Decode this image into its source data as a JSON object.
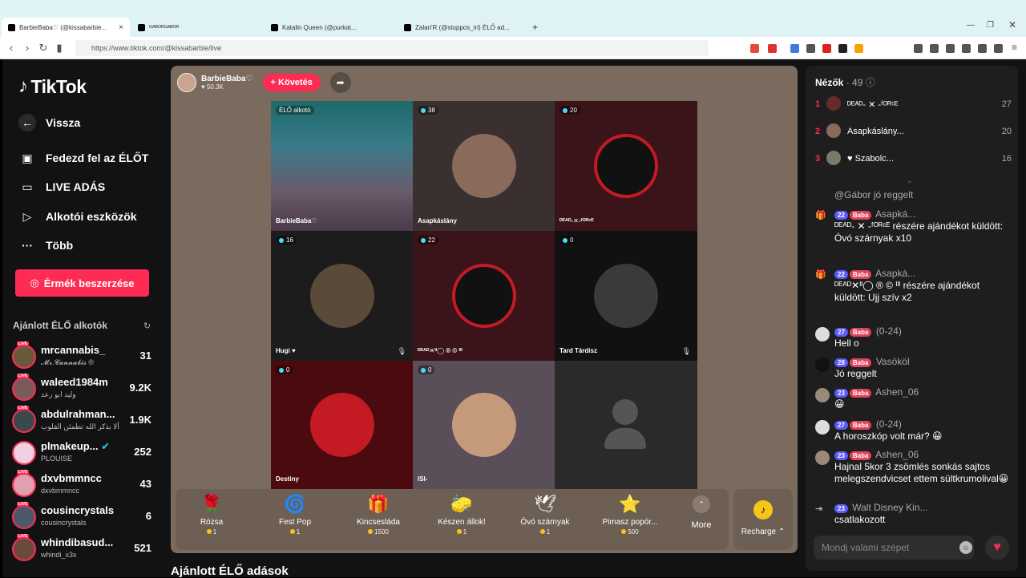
{
  "browser": {
    "tabs": [
      {
        "label": "BarbieBaba♡ (@kissabarbie...",
        "close": "×"
      },
      {
        "label": "ᴳᴬᴮᴼᴿᴳᴬᴮᴼᴿ"
      },
      {
        "label": "Katalin Queen (@purkat..."
      },
      {
        "label": "Zalan'R (@stoppos_iri) ÉLŐ ad..."
      }
    ],
    "new_tab": "+",
    "url": "https://www.tiktok.com/@kissabarbie/live"
  },
  "sidebar": {
    "logo": "TikTok",
    "back": "Vissza",
    "nav": [
      {
        "label": "Fedezd fel az ÉLŐT",
        "icon": "calendar-icon"
      },
      {
        "label": "LIVE ADÁS",
        "icon": "camera-icon"
      },
      {
        "label": "Alkotói eszközök",
        "icon": "play-icon"
      },
      {
        "label": "Több",
        "icon": "dots-icon"
      }
    ],
    "coins_button": "Érmék beszerzése",
    "recommended_title": "Ajánlott ÉLŐ alkotók",
    "recommended": [
      {
        "name": "mrcannabis_",
        "sub": "𝓜𝓻.𝓒𝓪𝓷𝓷𝓪𝓫𝓲𝓼 ®",
        "count": "31",
        "live": "LIVE"
      },
      {
        "name": "waleed1984m",
        "sub": "وليد ابو رعد",
        "count": "9.2K",
        "live": "LIVE"
      },
      {
        "name": "abdulrahman...",
        "sub": "ألا بذكر الله تطمئن القلوب",
        "count": "1.9K",
        "live": "LIVE"
      },
      {
        "name": "plmakeup...",
        "sub": "PLOUISE",
        "count": "252",
        "live": ""
      },
      {
        "name": "dxvbmmncc",
        "sub": "dxvbmmncc",
        "count": "43",
        "live": "LIVE"
      },
      {
        "name": "cousincrystals",
        "sub": "cousincrystals",
        "count": "6",
        "live": "LIVE"
      },
      {
        "name": "whindibasud...",
        "sub": "whindi_x3x",
        "count": "521",
        "live": "LIVE"
      }
    ],
    "bottom_title": "Ajánlott ÉLŐ adások"
  },
  "stage": {
    "host_name": "BarbieBaba♡",
    "host_likes": "♥ 50.3K",
    "follow": "+ Követés",
    "cells": [
      {
        "badge": "ÉLŐ alkotó",
        "label": "BarbieBaba♡",
        "bg": "#2b5a6a"
      },
      {
        "badge": "38",
        "label": "Asapkáslány",
        "bg": "#3a3030"
      },
      {
        "badge": "20",
        "label": "ᴰᴱᴬᴰ-✕-ᶠᴼᴿᶜᴱ",
        "bg": "#3a1418"
      },
      {
        "badge": "16",
        "label": "Hugi ♥",
        "bg": "#1c1c1c"
      },
      {
        "badge": "22",
        "label": "ᴰᴱᴬᴰ✕ᴵᴵ◯ ® © ᴵᴵᴵ",
        "bg": "#3a1418"
      },
      {
        "badge": "0",
        "label": "Tard Tárdisz",
        "bg": "#111"
      },
      {
        "badge": "0",
        "label": "Destiny",
        "bg": "#4a0a0e"
      },
      {
        "badge": "0",
        "label": "ISI-",
        "bg": "#5a4e58"
      },
      {
        "badge": "",
        "label": "",
        "bg": "#2a2a2a"
      }
    ],
    "gifts": [
      {
        "icon": "🌹",
        "name": "Rózsa",
        "price": "1"
      },
      {
        "icon": "🌀",
        "name": "Fest Pop",
        "price": "1"
      },
      {
        "icon": "🎁",
        "name": "Kincsesláda",
        "price": "1500"
      },
      {
        "icon": "🧽",
        "name": "Készen állok!",
        "price": "1"
      },
      {
        "icon": "🕊",
        "name": "Óvó szárnyak",
        "price": "1"
      },
      {
        "icon": "⭐",
        "name": "Pimasz popór...",
        "price": "500"
      }
    ],
    "more": "More",
    "recharge": "Recharge ⌃"
  },
  "chat": {
    "viewers_label": "Nézők",
    "viewers_count": "· 49",
    "viewers": [
      {
        "rank": "1",
        "name": "ᴰᴱᴬᴰ- ✕ -ᶠᴼᴿᶜᴱ",
        "score": "27"
      },
      {
        "rank": "2",
        "name": "Asapkáslány...",
        "score": "20"
      },
      {
        "rank": "3",
        "name": "♥ Szabolc...",
        "score": "16"
      }
    ],
    "messages": [
      {
        "lvl": "",
        "tag": "",
        "user": "",
        "text": "@Gábor jó reggelt"
      },
      {
        "lvl": "22",
        "tag": "Baba",
        "user": "Asapká...",
        "text": "ᴰᴱᴬᴰ- ✕ -ᶠᴼᴿᶜᴱ részére ajándékot küldött: Óvó szárnyak x10"
      },
      {
        "lvl": "22",
        "tag": "Baba",
        "user": "Asapká...",
        "text": "ᴰᴱᴬᴰ✕ᴵᴵ◯ ® © ᴵᴵᴵ részére ajándékot küldött: Ujj szív x2"
      },
      {
        "lvl": "27",
        "tag": "Baba",
        "user": "(0-24)",
        "text": "Hell o"
      },
      {
        "lvl": "28",
        "tag": "Baba",
        "user": "Vasököl",
        "text": "Jó reggelt"
      },
      {
        "lvl": "23",
        "tag": "Baba",
        "user": "Ashen_06",
        "text": "😀"
      },
      {
        "lvl": "27",
        "tag": "Baba",
        "user": "(0-24)",
        "text": "A horoszkóp volt már? 😀"
      },
      {
        "lvl": "23",
        "tag": "Baba",
        "user": "Ashen_06",
        "text": "Hajnal 5kor 3 zsömlés sonkás sajtos melegszendvicset ettem sültkrumolival😀"
      },
      {
        "lvl": "23",
        "tag": "",
        "user": "Walt Disney Kin...",
        "text": "csatlakozott"
      }
    ],
    "input_placeholder": "Mondj valami szépet"
  }
}
